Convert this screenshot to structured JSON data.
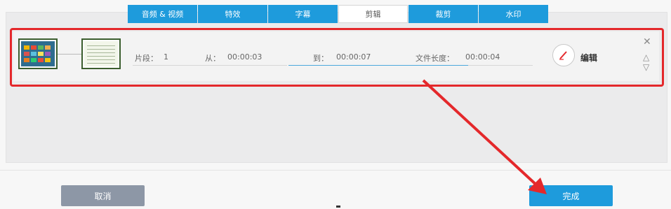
{
  "tabs": [
    {
      "label": "音频 & 视频"
    },
    {
      "label": "特效"
    },
    {
      "label": "字幕"
    },
    {
      "label": "剪辑"
    },
    {
      "label": "裁剪"
    },
    {
      "label": "水印"
    }
  ],
  "active_tab": "剪辑",
  "clip": {
    "segment_label": "片段：",
    "segment_value": "1",
    "from_label": "从：",
    "from_value": "00:00:03",
    "to_label": "到：",
    "to_value": "00:00:07",
    "length_label": "文件长度：",
    "length_value": "00:00:04",
    "edit_label": "编辑",
    "close_icon": "close-icon",
    "up_icon": "move-up-icon",
    "down_icon": "move-down-icon"
  },
  "buttons": {
    "cancel": "取消",
    "done": "完成"
  },
  "colors": {
    "accent": "#1e9bdc",
    "highlight": "#e4282b",
    "cancel": "#8d97a6"
  }
}
